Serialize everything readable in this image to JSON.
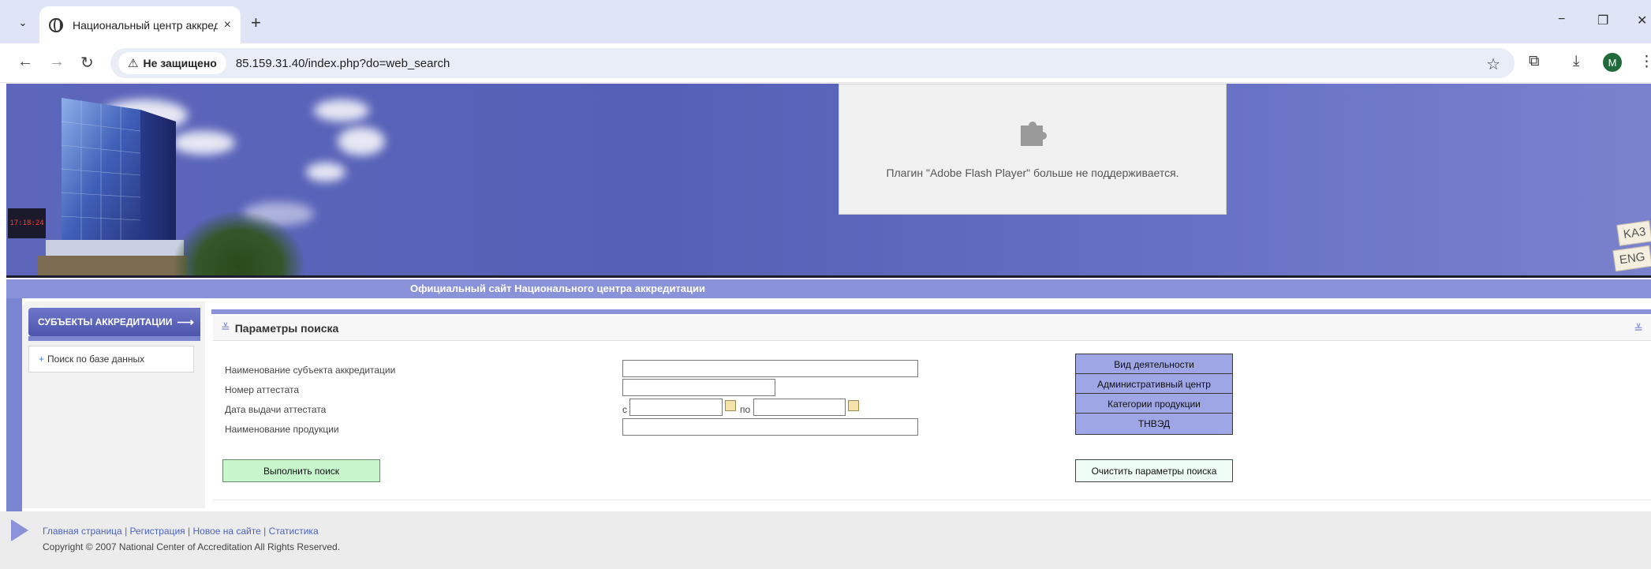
{
  "browser": {
    "tab_title": "Национальный центр аккредитации",
    "tab_close": "×",
    "new_tab": "+",
    "window": {
      "minimize": "−",
      "restore": "❐",
      "close": "✕"
    },
    "security_label": "Не защищено",
    "url": "85.159.31.40/index.php?do=web_search",
    "profile_initial": "M"
  },
  "banner": {
    "clock_text": "17:18:24",
    "flash_message": "Плагин \"Adobe Flash Player\" больше не поддерживается.",
    "lang_kz": "KA3",
    "lang_en": "ENG"
  },
  "site_title": "Официальный сайт Национального центра аккредитации",
  "sidebar": {
    "header": "СУБЪЕКТЫ АККРЕДИТАЦИИ",
    "items": [
      {
        "label": "Поиск по базе данных"
      }
    ]
  },
  "panel": {
    "title": "Параметры поиска"
  },
  "form": {
    "labels": {
      "subject_name": "Наименование субъекта аккредитации",
      "certificate_number": "Номер аттестата",
      "issue_date": "Дата выдачи аттестата",
      "product_name": "Наименование продукции",
      "from": "с",
      "to": "по"
    },
    "values": {
      "subject_name": "",
      "certificate_number": "",
      "date_from": "",
      "date_to": "",
      "product_name": ""
    },
    "buttons": {
      "activity_type": "Вид деятельности",
      "admin_center": "Административный центр",
      "product_categories": "Категории продукции",
      "tnved": "ТНВЭД",
      "search": "Выполнить поиск",
      "clear": "Очистить параметры поиска"
    }
  },
  "footer": {
    "links": [
      "Главная страница",
      "Регистрация",
      "Новое на сайте",
      "Статистика"
    ],
    "separator": " | ",
    "copyright": "Copyright © 2007 National Center of Accreditation All Rights Reserved."
  }
}
